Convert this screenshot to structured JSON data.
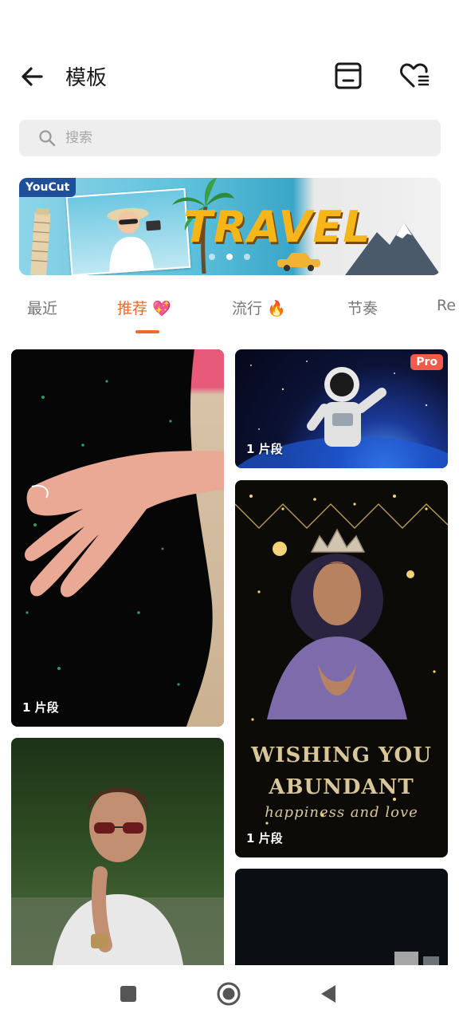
{
  "header": {
    "title": "模板",
    "back_icon": "arrow-left-icon",
    "actions": [
      {
        "name": "drafts-box",
        "icon": "box-icon"
      },
      {
        "name": "favorites",
        "icon": "heart-list-icon"
      }
    ]
  },
  "search": {
    "placeholder": "搜索",
    "value": "",
    "icon": "search-icon"
  },
  "banner": {
    "brand": "YouCut",
    "headline": "TRAVEL",
    "slide_count": 3,
    "active_slide": 2
  },
  "tabs": [
    {
      "label": "最近",
      "active": false
    },
    {
      "label": "推荐 💖",
      "active": true
    },
    {
      "label": "流行 🔥",
      "active": false
    },
    {
      "label": "节奏",
      "active": false
    },
    {
      "label": "Re",
      "active": false
    }
  ],
  "cards": [
    {
      "name": "hand-dress",
      "clips": "1 片段",
      "pro": false
    },
    {
      "name": "astronaut",
      "clips": "1 片段",
      "pro": true,
      "badge": "Pro"
    },
    {
      "name": "birthday-queen",
      "clips": "1 片段",
      "pro": false,
      "overlay_lines": [
        "WISHING YOU",
        "ABUNDANT",
        "happiness and love"
      ]
    },
    {
      "name": "sunglasses-man",
      "clips": "",
      "pro": false
    },
    {
      "name": "night-scene",
      "clips": "",
      "pro": false
    }
  ],
  "colors": {
    "accent": "#ef6a2c",
    "pro_badge": "#f25a4a",
    "search_bg": "#eeeeee"
  },
  "navbar": {
    "icons": [
      "recents-square-icon",
      "home-circle-icon",
      "back-triangle-icon"
    ]
  }
}
